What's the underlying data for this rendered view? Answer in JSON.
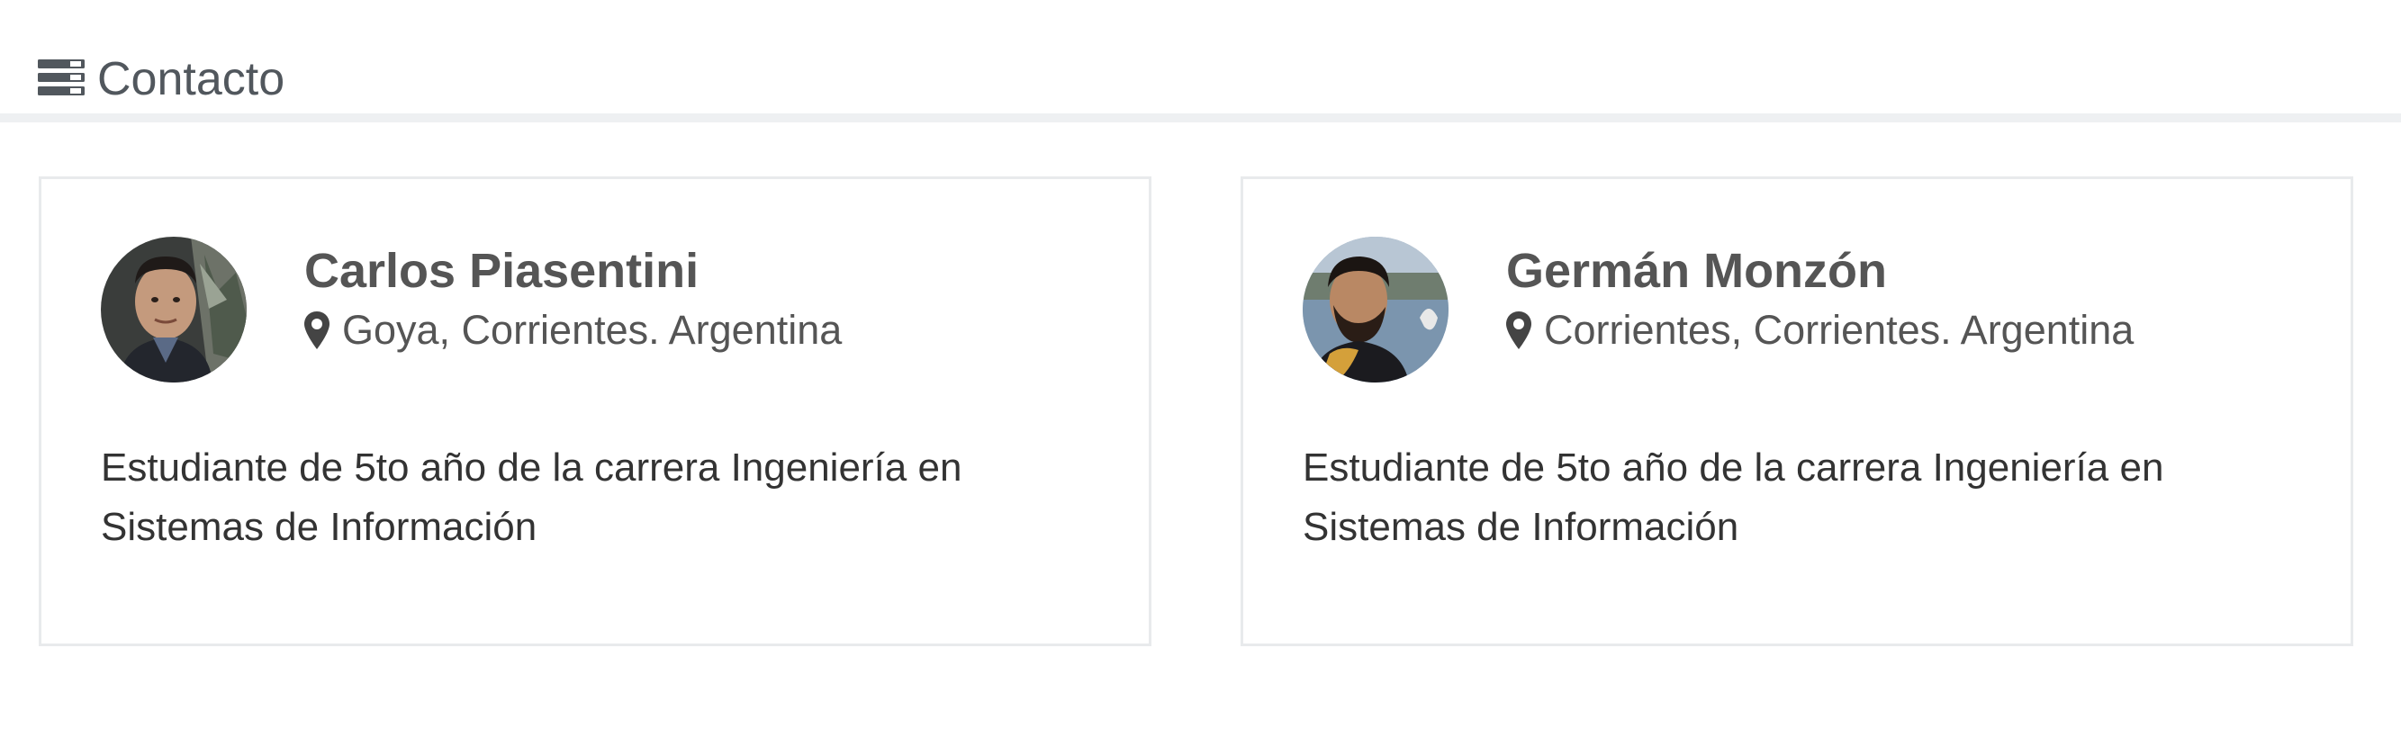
{
  "header": {
    "icon": "list-icon",
    "title": "Contacto"
  },
  "contacts": [
    {
      "name": "Carlos Piasentini",
      "location_icon": "map-pin-icon",
      "location": "Goya, Corrientes. Argentina",
      "description": "Estudiante de 5to año de la carrera Ingeniería en Sistemas de Información"
    },
    {
      "name": "Germán Monzón",
      "location_icon": "map-pin-icon",
      "location": "Corrientes, Corrientes. Argentina",
      "description": "Estudiante de 5to año de la carrera Ingeniería en Sistemas de Información"
    }
  ],
  "colors": {
    "text_dark": "#555555",
    "text_body": "#333333",
    "header_text": "#51575d",
    "card_border": "#e8eaec"
  }
}
